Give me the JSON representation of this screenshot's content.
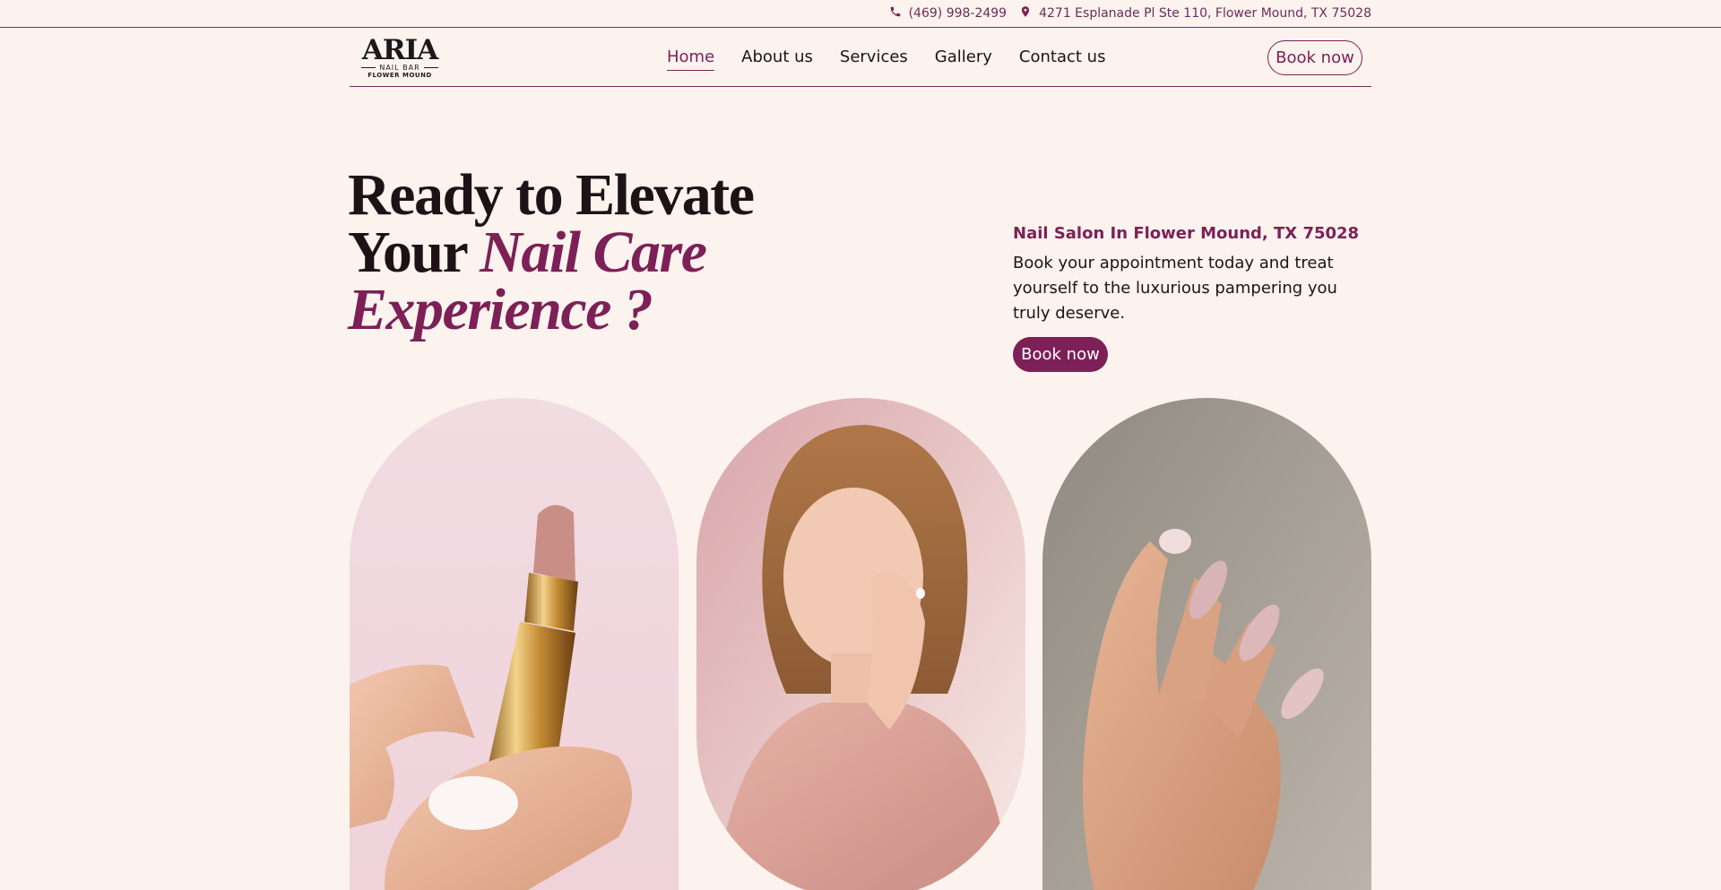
{
  "topbar": {
    "phone_icon": "phone-icon",
    "phone": "(469) 998-2499",
    "location_icon": "map-pin-icon",
    "address": "4271 Esplanade Pl Ste 110, Flower Mound, TX 75028"
  },
  "logo": {
    "main": "ARIA",
    "sub": "NAIL BAR",
    "sub2": "FLOWER MOUND"
  },
  "nav": {
    "items": [
      "Home",
      "About us",
      "Services",
      "Gallery",
      "Contact us"
    ],
    "active": "Home"
  },
  "header": {
    "book_label": "Book now"
  },
  "hero": {
    "title_line1": "Ready to Elevate",
    "title_line2_plain": "Your ",
    "title_line2_accent": "Nail Care",
    "title_line3_accent": "Experience ?",
    "subheading": "Nail Salon In Flower Mound, TX 75028",
    "description": "Book your appointment today and treat yourself to the luxurious pampering you truly deserve.",
    "book_label": "Book now"
  },
  "gallery": {
    "images": [
      "lipstick-photo",
      "woman-portrait-photo",
      "manicured-hand-photo"
    ]
  },
  "colors": {
    "background": "#fcf3ee",
    "accent": "#7d2057",
    "text": "#1e1216"
  }
}
